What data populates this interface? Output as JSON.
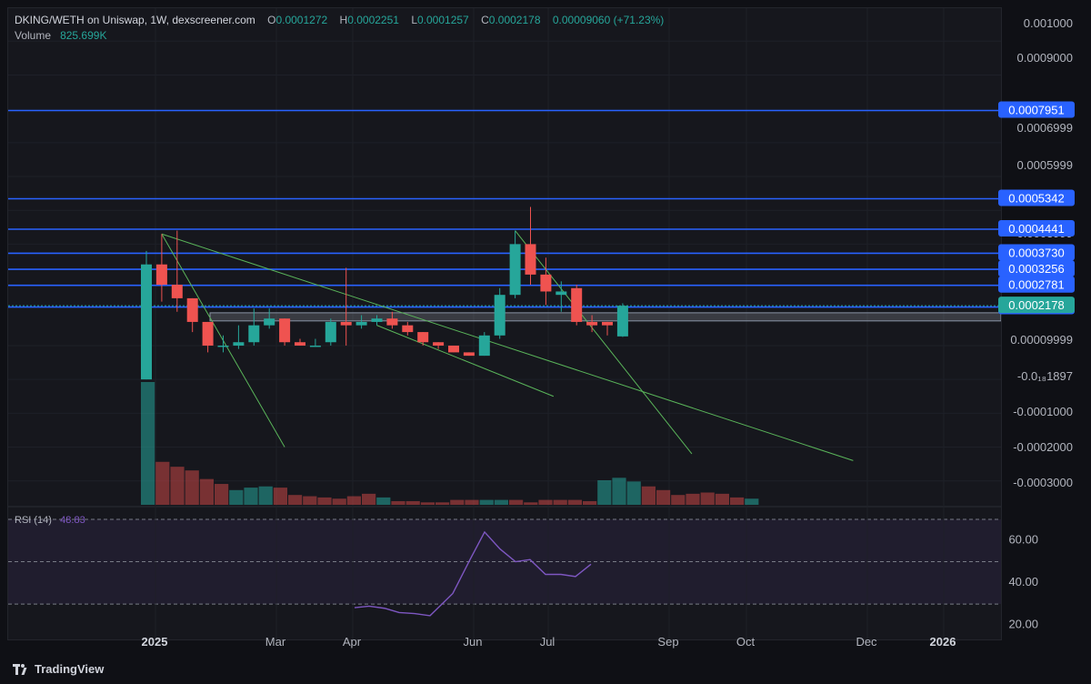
{
  "header": {
    "pair": "DKING/WETH on Uniswap, 1W, dexscreener.com",
    "o_label": "O",
    "o_value": "0.0001272",
    "h_label": "H",
    "h_value": "0.0002251",
    "l_label": "L",
    "l_value": "0.0001257",
    "c_label": "C",
    "c_value": "0.0002178",
    "change": "0.00009060 (+71.23%)",
    "volume_label": "Volume",
    "volume_value": "825.699K"
  },
  "rsi_panel": {
    "label": "RSI (14)",
    "value": "48.83"
  },
  "footer": {
    "brand": "TradingView"
  },
  "colors": {
    "background": "#16171d",
    "up": "#26a69a",
    "down": "#ef5350",
    "level_line": "#2962ff",
    "trendline": "#5ab55a",
    "rsi_line": "#7e57c2"
  },
  "chart_data": [
    {
      "type": "candlestick",
      "title": "DKING/WETH on Uniswap, 1W",
      "x_tick_labels": [
        "2025",
        "Mar",
        "Apr",
        "Jun",
        "Jul",
        "Sep",
        "Oct",
        "Dec",
        "2026"
      ],
      "y_tick_labels": [
        "0.001000",
        "0.0009000",
        "0.0006999",
        "0.0005999",
        "0.0004999",
        "0.0003999",
        "0.00009999",
        "-0.0₁₈1897",
        "-0.0001000",
        "-0.0002000",
        "-0.0003000"
      ],
      "ylim": [
        -0.00036,
        0.00106
      ],
      "candles": [
        {
          "o": 0.0,
          "h": 0.00038,
          "l": 0.0,
          "c": 0.00034
        },
        {
          "o": 0.00034,
          "h": 0.00043,
          "l": 0.00023,
          "c": 0.00028
        },
        {
          "o": 0.00028,
          "h": 0.00044,
          "l": 0.0002,
          "c": 0.00024
        },
        {
          "o": 0.00024,
          "h": 0.00024,
          "l": 0.00014,
          "c": 0.00017
        },
        {
          "o": 0.00017,
          "h": 0.00017,
          "l": 8e-05,
          "c": 0.0001
        },
        {
          "o": 0.0001,
          "h": 0.00013,
          "l": 8e-05,
          "c": 0.0001
        },
        {
          "o": 0.0001,
          "h": 0.00016,
          "l": 9e-05,
          "c": 0.00011
        },
        {
          "o": 0.00011,
          "h": 0.00021,
          "l": 0.0001,
          "c": 0.00016
        },
        {
          "o": 0.00016,
          "h": 0.00021,
          "l": 0.00015,
          "c": 0.00018
        },
        {
          "o": 0.00018,
          "h": 0.00018,
          "l": 0.0001,
          "c": 0.00011
        },
        {
          "o": 0.00011,
          "h": 0.00012,
          "l": 0.0001,
          "c": 0.0001
        },
        {
          "o": 0.0001,
          "h": 0.00012,
          "l": 0.0001,
          "c": 0.0001
        },
        {
          "o": 0.00011,
          "h": 0.00018,
          "l": 0.0001,
          "c": 0.00017
        },
        {
          "o": 0.00017,
          "h": 0.00033,
          "l": 0.0001,
          "c": 0.00016
        },
        {
          "o": 0.00016,
          "h": 0.00019,
          "l": 0.00015,
          "c": 0.00017
        },
        {
          "o": 0.00017,
          "h": 0.00019,
          "l": 0.00016,
          "c": 0.00018
        },
        {
          "o": 0.00018,
          "h": 0.0002,
          "l": 0.00015,
          "c": 0.00016
        },
        {
          "o": 0.00016,
          "h": 0.00017,
          "l": 0.00013,
          "c": 0.00014
        },
        {
          "o": 0.00014,
          "h": 0.00014,
          "l": 0.0001,
          "c": 0.00011
        },
        {
          "o": 0.00011,
          "h": 0.00011,
          "l": 9e-05,
          "c": 0.0001
        },
        {
          "o": 0.0001,
          "h": 0.0001,
          "l": 8e-05,
          "c": 8e-05
        },
        {
          "o": 8e-05,
          "h": 8e-05,
          "l": 7e-05,
          "c": 7e-05
        },
        {
          "o": 7e-05,
          "h": 0.00014,
          "l": 7e-05,
          "c": 0.00013
        },
        {
          "o": 0.00013,
          "h": 0.00027,
          "l": 0.00012,
          "c": 0.00025
        },
        {
          "o": 0.00025,
          "h": 0.00044,
          "l": 0.00024,
          "c": 0.0004
        },
        {
          "o": 0.0004,
          "h": 0.00051,
          "l": 0.00028,
          "c": 0.00031
        },
        {
          "o": 0.00031,
          "h": 0.00036,
          "l": 0.00022,
          "c": 0.00026
        },
        {
          "o": 0.00025,
          "h": 0.00029,
          "l": 0.0002,
          "c": 0.00026
        },
        {
          "o": 0.00027,
          "h": 0.00028,
          "l": 0.00016,
          "c": 0.00017
        },
        {
          "o": 0.00017,
          "h": 0.00019,
          "l": 0.00014,
          "c": 0.00016
        },
        {
          "o": 0.00017,
          "h": 0.00017,
          "l": 0.00013,
          "c": 0.00016
        },
        {
          "o": 0.0001272,
          "h": 0.0002251,
          "l": 0.0001257,
          "c": 0.0002178
        }
      ],
      "horizontal_levels": [
        "0.0007951",
        "0.0005342",
        "0.0004441",
        "0.0003730",
        "0.0003256",
        "0.0002781",
        "0.0002141"
      ],
      "last_price_label": "0.0002178",
      "zone": {
        "top": 0.000197,
        "bottom": 0.000173
      }
    },
    {
      "type": "bar",
      "title": "Volume",
      "values": [
        100,
        35,
        31,
        28,
        21,
        17,
        12,
        14,
        15,
        14,
        8,
        7,
        6,
        5,
        7,
        9,
        6,
        3,
        3,
        2,
        2,
        4,
        4,
        4,
        4,
        4,
        2,
        4,
        4,
        4,
        3,
        20,
        22,
        19,
        15,
        12,
        8,
        9,
        10,
        9,
        6,
        5
      ]
    },
    {
      "type": "line",
      "title": "RSI (14)",
      "y_tick_labels": [
        "60.00",
        "40.00",
        "20.00"
      ],
      "ylim": [
        15,
        70
      ],
      "bands": [
        70,
        50,
        30
      ],
      "values": [
        28.3,
        29,
        28,
        26,
        25.5,
        24.5,
        35,
        51,
        64,
        56,
        50,
        51,
        44,
        44,
        43,
        48.83
      ]
    }
  ]
}
